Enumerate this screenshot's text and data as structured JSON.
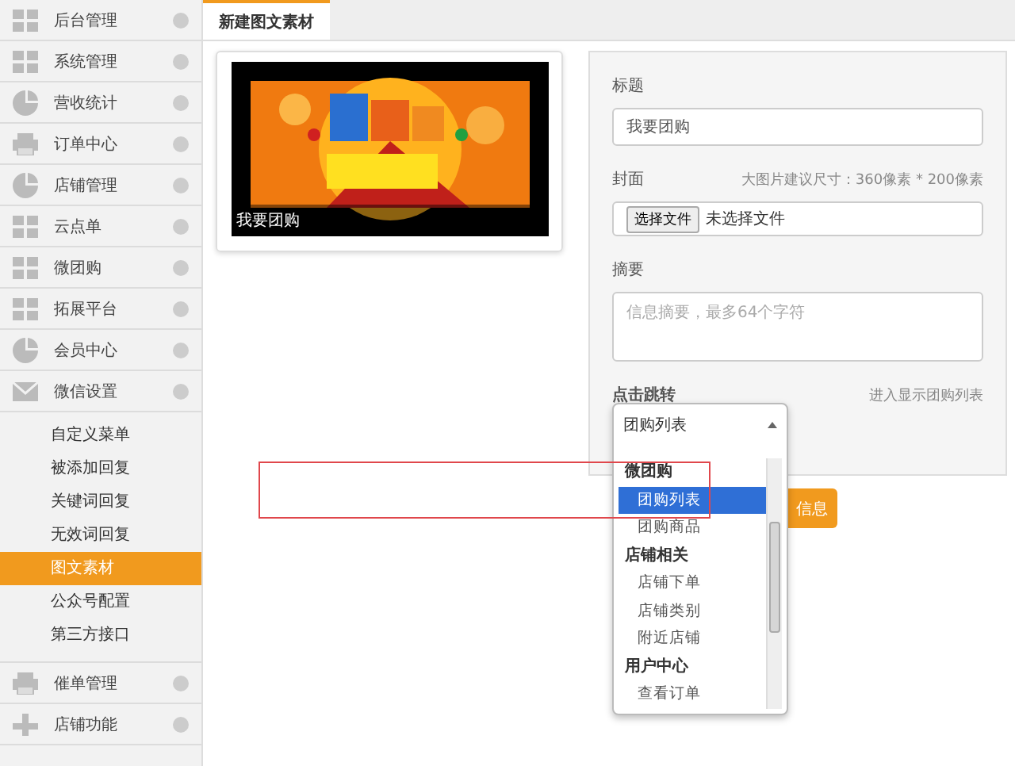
{
  "sidebar": {
    "items": [
      {
        "label": "后台管理",
        "kind": "grid"
      },
      {
        "label": "系统管理",
        "kind": "grid"
      },
      {
        "label": "营收统计",
        "kind": "pie"
      },
      {
        "label": "订单中心",
        "kind": "printer"
      },
      {
        "label": "店铺管理",
        "kind": "pie"
      },
      {
        "label": "云点单",
        "kind": "grid"
      },
      {
        "label": "微团购",
        "kind": "grid"
      },
      {
        "label": "拓展平台",
        "kind": "grid"
      },
      {
        "label": "会员中心",
        "kind": "pie"
      },
      {
        "label": "微信设置",
        "kind": "mail",
        "children": [
          {
            "label": "自定义菜单",
            "selected": false
          },
          {
            "label": "被添加回复",
            "selected": false
          },
          {
            "label": "关键词回复",
            "selected": false
          },
          {
            "label": "无效词回复",
            "selected": false
          },
          {
            "label": "图文素材",
            "selected": true
          },
          {
            "label": "公众号配置",
            "selected": false
          },
          {
            "label": "第三方接口",
            "selected": false
          }
        ]
      },
      {
        "label": "催单管理",
        "kind": "printer"
      },
      {
        "label": "店铺功能",
        "kind": "plus"
      }
    ]
  },
  "tabs": [
    {
      "label": "新建图文素材",
      "selected": true
    }
  ],
  "preview": {
    "caption": "我要团购"
  },
  "form": {
    "title_label": "标题",
    "title_value": "我要团购",
    "cover_label": "封面",
    "cover_hint": "大图片建议尺寸：360像素 * 200像素",
    "file_button": "选择文件",
    "file_status": "未选择文件",
    "summary_label": "摘要",
    "summary_placeholder": "信息摘要，最多64个字符",
    "link_label": "点击跳转",
    "link_hint": "进入显示团购列表",
    "submit_label": "信息"
  },
  "dropdown": {
    "value": "团购列表",
    "options": [
      {
        "label": "微团购",
        "kind": "group",
        "selected": false
      },
      {
        "label": "团购列表",
        "kind": "option",
        "selected": true
      },
      {
        "label": "团购商品",
        "kind": "option",
        "selected": false
      },
      {
        "label": "店铺相关",
        "kind": "group",
        "selected": false
      },
      {
        "label": "店铺下单",
        "kind": "option",
        "selected": false
      },
      {
        "label": "店铺类别",
        "kind": "option",
        "selected": false
      },
      {
        "label": "附近店铺",
        "kind": "option",
        "selected": false
      },
      {
        "label": "用户中心",
        "kind": "group",
        "selected": false
      },
      {
        "label": "查看订单",
        "kind": "option",
        "selected": false
      }
    ]
  }
}
